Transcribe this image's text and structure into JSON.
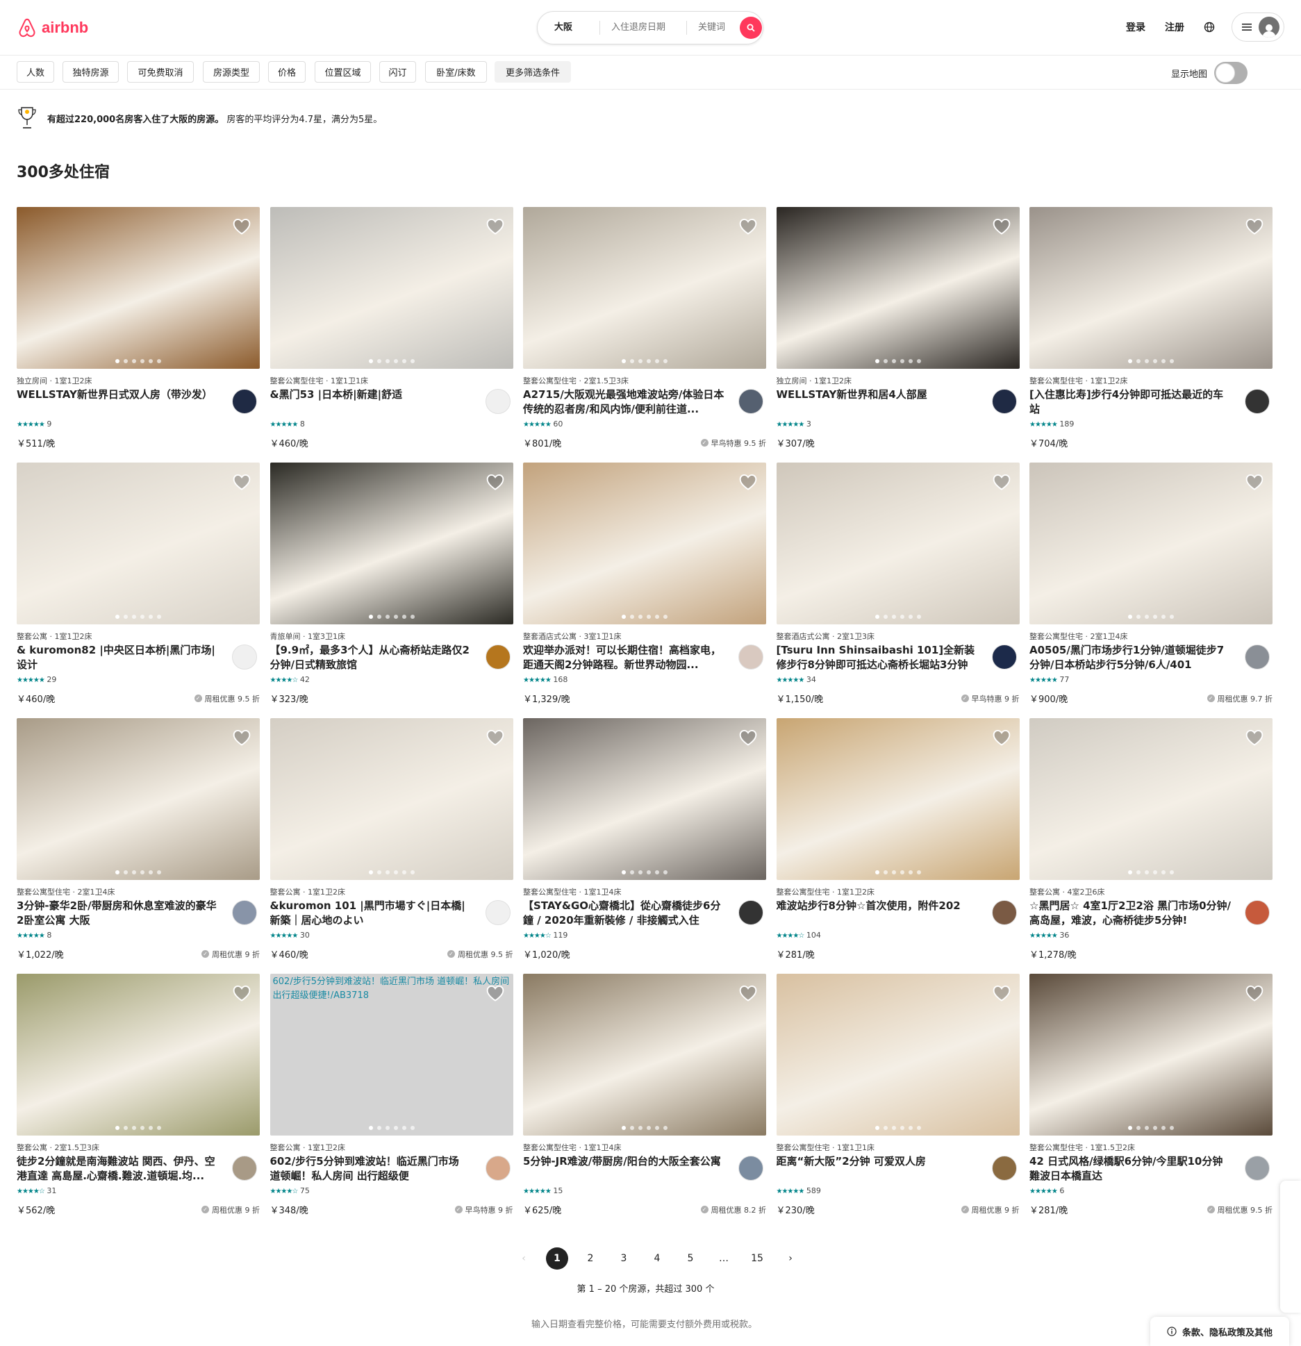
{
  "header": {
    "logo_text": "airbnb",
    "brand_color": "#ff385c",
    "search": {
      "location": "大阪",
      "dates": "入住退房日期",
      "keyword": "关键词"
    },
    "login": "登录",
    "signup": "注册"
  },
  "filters": {
    "chips": [
      "人数",
      "独特房源",
      "可免费取消",
      "房源类型",
      "价格",
      "位置区域",
      "闪订",
      "卧室/床数",
      "更多筛选条件"
    ],
    "map_label": "显示地图"
  },
  "banner": {
    "bold": "有超过220,000名房客入住了大阪的房源。",
    "rest": "房客的平均评分为4.7星，满分为5星。"
  },
  "results_title": "300多处住宿",
  "listings": [
    {
      "meta": "独立房间 · 1室1卫2床",
      "title": "WELLSTAY新世界日式双人房（带沙发）",
      "stars": "★★★★★",
      "reviews": "9",
      "price": "￥511/晚",
      "badge": "",
      "photo": "#8b5a2b",
      "host": "#1f2a44",
      "alt": ""
    },
    {
      "meta": "整套公寓型住宅 · 1室1卫1床",
      "title": "&黑门53 |日本桥|新建|舒适",
      "stars": "★★★★★",
      "reviews": "8",
      "price": "￥460/晚",
      "badge": "",
      "photo": "#bdbcb8",
      "host": "#f0f0f0",
      "alt": ""
    },
    {
      "meta": "整套公寓型住宅 · 2室1.5卫3床",
      "title": "A2715/大阪观光最强地难波站旁/体验日本传统的忍者房/和风内饰/便利前往道...",
      "stars": "★★★★★",
      "reviews": "60",
      "price": "￥801/晚",
      "badge": "早鸟特惠 9.5 折",
      "photo": "#b0a89a",
      "host": "#556070",
      "alt": ""
    },
    {
      "meta": "独立房间 · 1室1卫2床",
      "title": "WELLSTAY新世界和居4人部屋",
      "stars": "★★★★★",
      "reviews": "3",
      "price": "￥307/晚",
      "badge": "",
      "photo": "#2a2622",
      "host": "#1f2a44",
      "alt": ""
    },
    {
      "meta": "整套公寓型住宅 · 1室1卫2床",
      "title": "[入住惠比寿]步行4分钟即可抵达最近的车站",
      "stars": "★★★★★",
      "reviews": "189",
      "price": "￥704/晚",
      "badge": "",
      "photo": "#9a928a",
      "host": "#333333",
      "alt": ""
    },
    {
      "meta": "整套公寓 · 1室1卫2床",
      "title": "& kuromon82 |中央区日本桥|黑门市场|设计",
      "stars": "★★★★★",
      "reviews": "29",
      "price": "￥460/晚",
      "badge": "周租优惠 9.5 折",
      "photo": "#d8d2c8",
      "host": "#f0f0f0",
      "alt": ""
    },
    {
      "meta": "青旅单间 · 1室3卫1床",
      "title": "【9.9㎡，最多3个人】从心斋桥站走路仅2分钟/日式精致旅馆",
      "stars": "★★★★☆",
      "reviews": "42",
      "price": "￥323/晚",
      "badge": "",
      "photo": "#2b2a24",
      "host": "#b5761e",
      "alt": ""
    },
    {
      "meta": "整套酒店式公寓 · 3室1卫1床",
      "title": "欢迎举办派对！可以长期住宿！高档家电，距通天阁2分钟路程。新世界动物园...",
      "stars": "★★★★★",
      "reviews": "168",
      "price": "￥1,329/晚",
      "badge": "",
      "photo": "#c2a27c",
      "host": "#d9c9c0",
      "alt": ""
    },
    {
      "meta": "整套酒店式公寓 · 2室1卫3床",
      "title": "[Tsuru Inn Shinsaibashi 101]全新装修步行8分钟即可抵达心斋桥长堀站3分钟",
      "stars": "★★★★★",
      "reviews": "34",
      "price": "￥1,150/晚",
      "badge": "早鸟特惠 9 折",
      "photo": "#cfc7bb",
      "host": "#1c2a4a",
      "alt": ""
    },
    {
      "meta": "整套公寓型住宅 · 2室1卫4床",
      "title": "A0505/黑门市场步行1分钟/道顿堀徒步7分钟/日本桥站步行5分钟/6人/401",
      "stars": "★★★★★",
      "reviews": "77",
      "price": "￥900/晚",
      "badge": "周租优惠 9.7 折",
      "photo": "#cbc4ba",
      "host": "#8a8f96",
      "alt": ""
    },
    {
      "meta": "整套公寓型住宅 · 2室1卫4床",
      "title": "3分钟-豪华2卧/带厨房和休息室难波的豪华2卧室公寓 大阪",
      "stars": "★★★★★",
      "reviews": "8",
      "price": "￥1,022/晚",
      "badge": "周租优惠 9 折",
      "photo": "#a89b87",
      "host": "#8894a8",
      "alt": ""
    },
    {
      "meta": "整套公寓 · 1室1卫2床",
      "title": "&kuromon 101 |黒門市場すぐ|日本橋|新築｜居心地のよい",
      "stars": "★★★★★",
      "reviews": "30",
      "price": "￥460/晚",
      "badge": "周租优惠 9.5 折",
      "photo": "#d4cec4",
      "host": "#f0f0f0",
      "alt": ""
    },
    {
      "meta": "整套公寓型住宅 · 1室1卫4床",
      "title": "【STAY&GO心齋橋北】從心齋橋徒步6分鐘 / 2020年重新裝修 / 非接觸式入住",
      "stars": "★★★★☆",
      "reviews": "119",
      "price": "￥1,020/晚",
      "badge": "",
      "photo": "#6b6560",
      "host": "#333333",
      "alt": ""
    },
    {
      "meta": "整套公寓型住宅 · 1室1卫2床",
      "title": "难波站步行8分钟☆首次使用，附件202",
      "stars": "★★★★☆",
      "reviews": "104",
      "price": "￥281/晚",
      "badge": "",
      "photo": "#c8a572",
      "host": "#7a5a44",
      "alt": ""
    },
    {
      "meta": "整套公寓 · 4室2卫6床",
      "title": "☆黑門居☆ 4室1厅2卫2浴 黑门市场0分钟/高岛屋，难波，心斋桥徒步5分钟!",
      "stars": "★★★★★",
      "reviews": "36",
      "price": "￥1,278/晚",
      "badge": "",
      "photo": "#d0cbc2",
      "host": "#c65a3c",
      "alt": ""
    },
    {
      "meta": "整套公寓 · 2室1.5卫3床",
      "title": "徒步2分鐘就是南海難波站 関西、伊丹、空港直達 高島屋.心齋橋.難波.道頓堀.均...",
      "stars": "★★★★☆",
      "reviews": "31",
      "price": "￥562/晚",
      "badge": "周租优惠 9 折",
      "photo": "#9a9a6a",
      "host": "#a89a86",
      "alt": ""
    },
    {
      "meta": "整套公寓 · 1室1卫2床",
      "title": "602/步行5分钟到难波站！临近黑门市场 道顿崛！私人房间 出行超级便捷!/AB3718",
      "stars": "★★★★☆",
      "reviews": "75",
      "price": "￥348/晚",
      "badge": "早鸟特惠 9 折",
      "photo": "#d3d3d3",
      "host": "#d8a88a",
      "alt": "602/步行5分钟到难波站！临近黑门市场 道顿崛！私人房间 出行超级便捷!/AB3718"
    },
    {
      "meta": "整套公寓型住宅 · 1室1卫4床",
      "title": "5分钟-JR难波/带厨房/阳台的大阪全套公寓",
      "stars": "★★★★★",
      "reviews": "15",
      "price": "￥625/晚",
      "badge": "周租优惠 8.2 折",
      "photo": "#8a7a62",
      "host": "#7b8ca0",
      "alt": ""
    },
    {
      "meta": "整套公寓型住宅 · 1室1卫1床",
      "title": "距离“新大阪”2分钟 可爱双人房",
      "stars": "★★★★★",
      "reviews": "589",
      "price": "￥230/晚",
      "badge": "周租优惠 9 折",
      "photo": "#d8c0a0",
      "host": "#8a6a40",
      "alt": ""
    },
    {
      "meta": "整套公寓型住宅 · 1室1.5卫2床",
      "title": "42 日式风格/绿橋駅6分钟/今里駅10分钟 難波日本橋直达",
      "stars": "★★★★★",
      "reviews": "6",
      "price": "￥281/晚",
      "badge": "周租优惠 9.5 折",
      "photo": "#5a4a3a",
      "host": "#9aa0a6",
      "alt": ""
    }
  ],
  "pagination": {
    "prev": "‹",
    "pages": [
      "1",
      "2",
      "3",
      "4",
      "5",
      "…",
      "15"
    ],
    "next": "›",
    "current": "1"
  },
  "range_text": "第 1 – 20 个房源，共超过 300 个",
  "footnote": "输入日期查看完整价格，可能需要支付额外费用或税款。",
  "terms_label": "条款、隐私政策及其他"
}
